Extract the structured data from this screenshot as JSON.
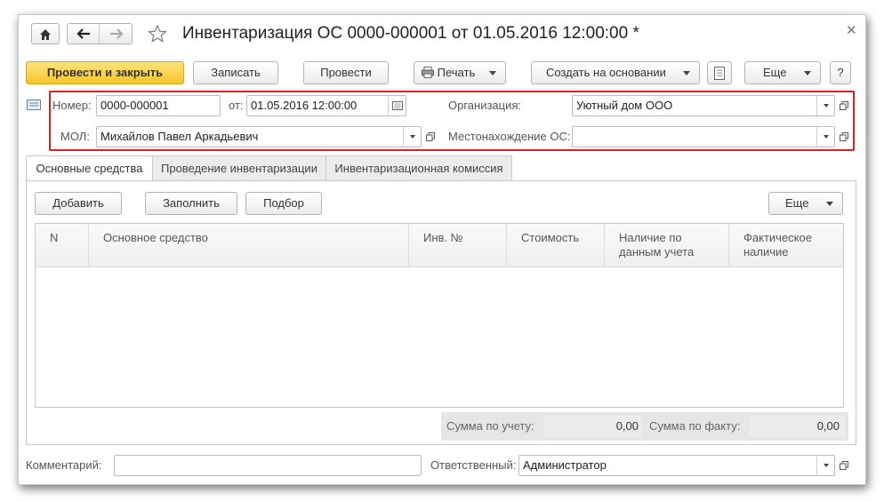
{
  "window": {
    "title": "Инвентаризация ОС 0000-000001 от 01.05.2016 12:00:00 *"
  },
  "toolbar": {
    "post_close": "Провести и закрыть",
    "save": "Записать",
    "post": "Провести",
    "print": "Печать",
    "create_based": "Создать на основании",
    "more": "Еще",
    "help": "?"
  },
  "header": {
    "number_label": "Номер:",
    "number_value": "0000-000001",
    "date_label": "от:",
    "date_value": "01.05.2016 12:00:00",
    "org_label": "Организация:",
    "org_value": "Уютный дом ООО",
    "mol_label": "МОЛ:",
    "mol_value": "Михайлов Павел Аркадьевич",
    "location_label": "Местонахождение ОС:",
    "location_value": ""
  },
  "tabs": [
    {
      "label": "Основные средства",
      "active": true
    },
    {
      "label": "Проведение инвентаризации",
      "active": false
    },
    {
      "label": "Инвентаризационная комиссия",
      "active": false
    }
  ],
  "table_toolbar": {
    "add": "Добавить",
    "fill": "Заполнить",
    "pick": "Подбор",
    "more": "Еще"
  },
  "table": {
    "columns": [
      "N",
      "Основное средство",
      "Инв. №",
      "Стоимость",
      "Наличие по данным учета",
      "Фактическое наличие"
    ],
    "rows": []
  },
  "totals": {
    "accounting_label": "Сумма по учету:",
    "accounting_value": "0,00",
    "actual_label": "Сумма по факту:",
    "actual_value": "0,00"
  },
  "footer": {
    "comment_label": "Комментарий:",
    "comment_value": "",
    "responsible_label": "Ответственный:",
    "responsible_value": "Администратор"
  },
  "colors": {
    "highlight_border": "#e02020",
    "primary_button": "#f7c52b"
  }
}
